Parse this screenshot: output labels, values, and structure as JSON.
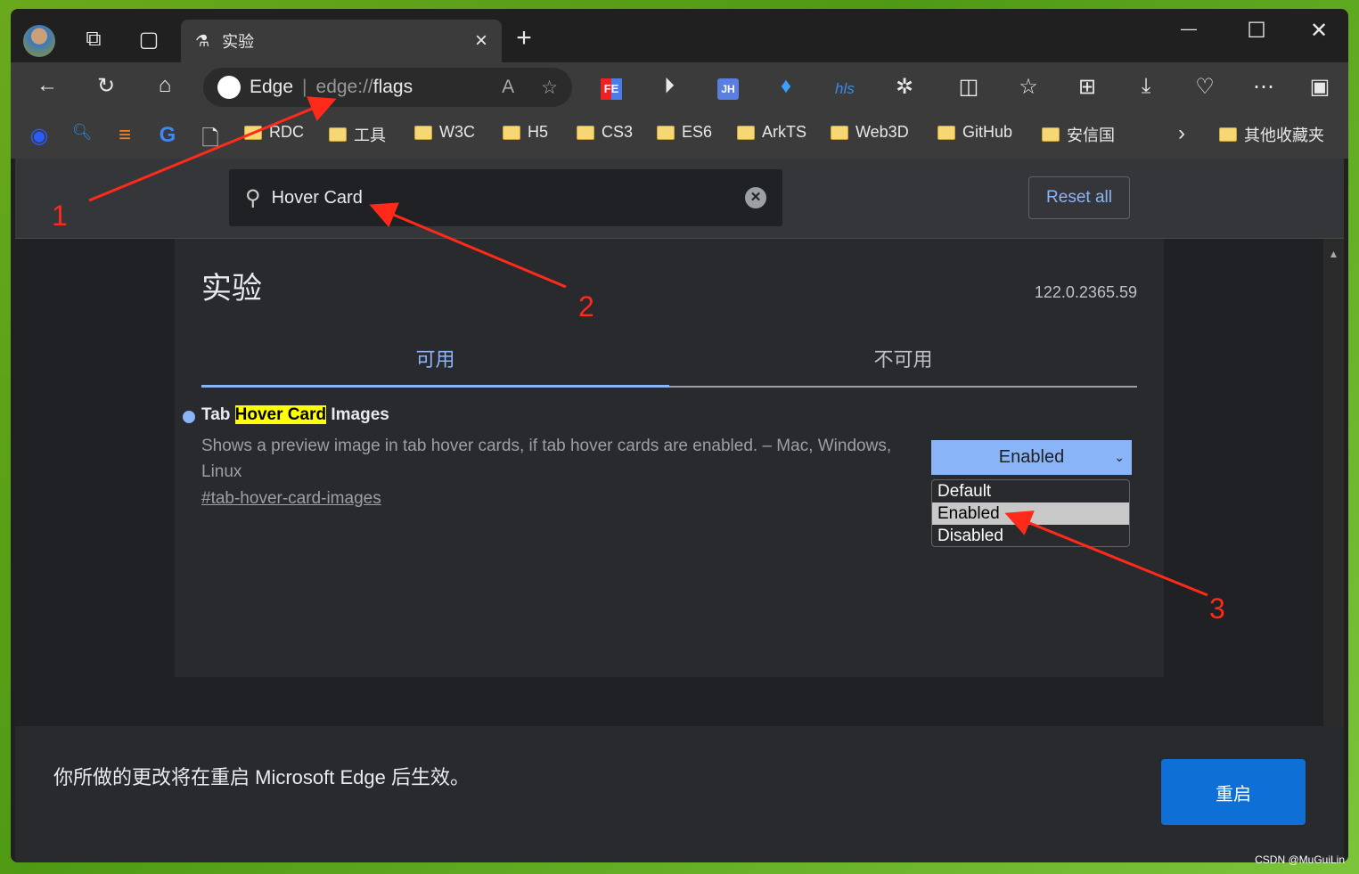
{
  "tab": {
    "title": "实验",
    "close": "×",
    "new_tab": "+"
  },
  "window": {
    "minimize": "—",
    "maximize": "☐",
    "close": "✕"
  },
  "address": {
    "brand": "Edge",
    "url_prefix": "edge://",
    "url_path": "flags"
  },
  "extensions": [
    "FE",
    "JH",
    "hls"
  ],
  "bookmarks": [
    "RDC",
    "工具",
    "W3C",
    "H5",
    "CS3",
    "ES6",
    "ArkTS",
    "Web3D",
    "GitHub",
    "安信国"
  ],
  "other_bookmarks": "其他收藏夹",
  "search": {
    "value": "Hover Card"
  },
  "reset_label": "Reset all",
  "page": {
    "title": "实验",
    "version": "122.0.2365.59",
    "tabs": [
      "可用",
      "不可用"
    ]
  },
  "flag": {
    "name_pre": "Tab ",
    "name_highlight": "Hover Card",
    "name_post": " Images",
    "description": "Shows a preview image in tab hover cards, if tab hover cards are enabled. – Mac, Windows, Linux",
    "link": "#tab-hover-card-images",
    "selected": "Enabled",
    "options": [
      "Default",
      "Enabled",
      "Disabled"
    ]
  },
  "footer": {
    "message": "你所做的更改将在重启 Microsoft Edge 后生效。",
    "restart": "重启"
  },
  "annotations": [
    "1",
    "2",
    "3"
  ],
  "watermark": "CSDN @MuGuiLin",
  "colors": {
    "accent": "#8ab4f8",
    "restart": "#0e6fd6",
    "highlight": "#ffff00",
    "arrow": "#ff2a1a"
  }
}
